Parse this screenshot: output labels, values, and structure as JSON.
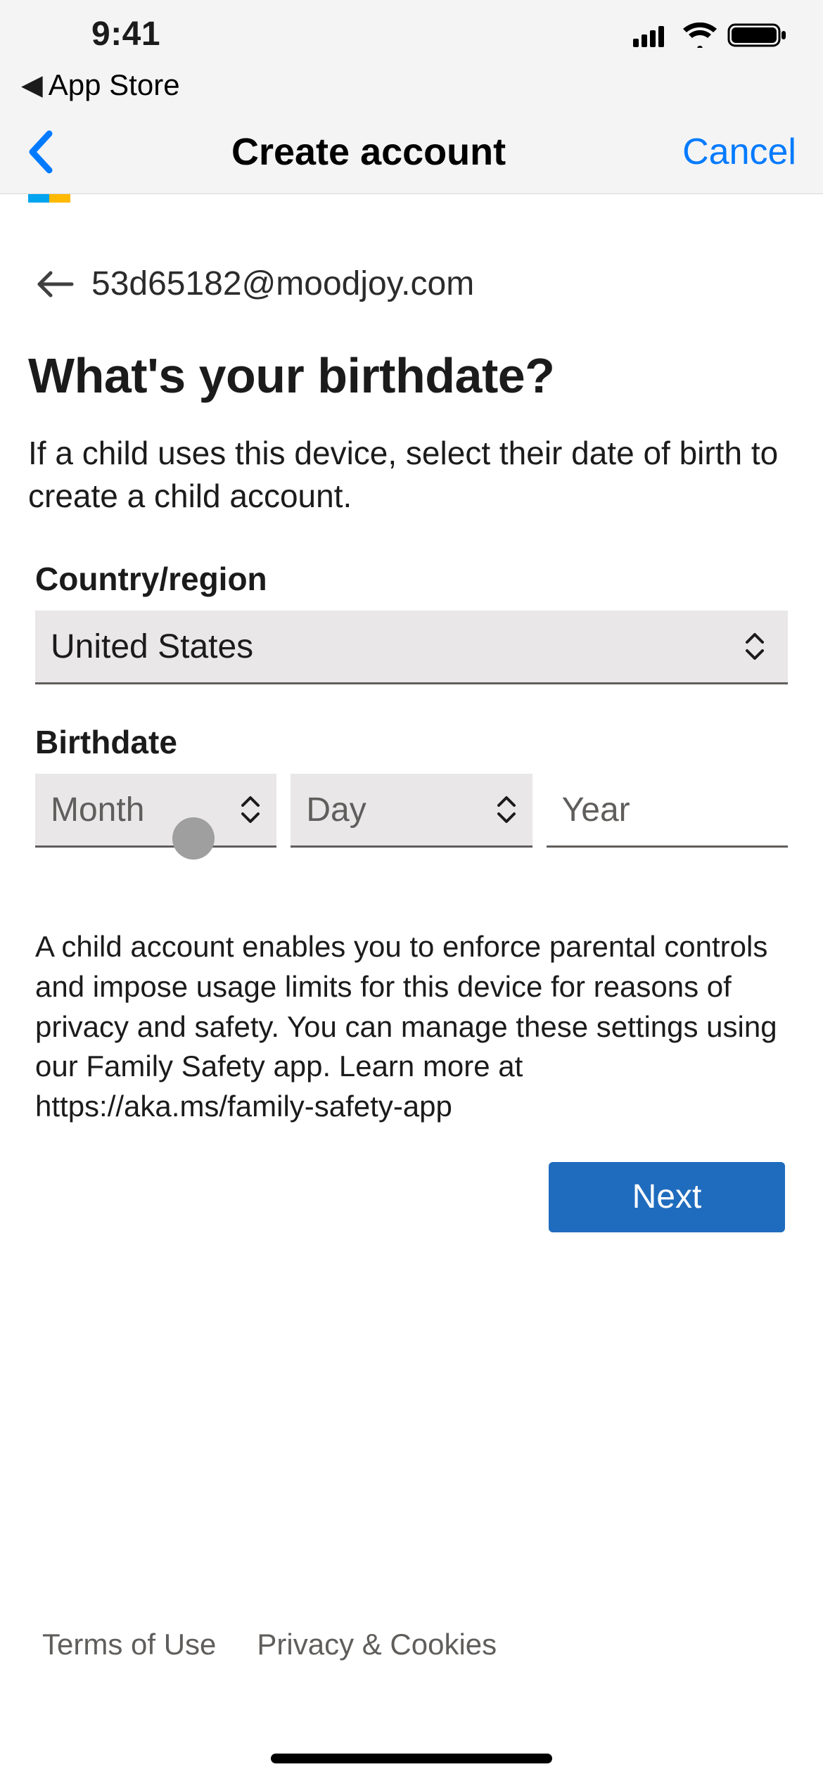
{
  "status": {
    "time": "9:41"
  },
  "back_app": {
    "label": "App Store"
  },
  "nav": {
    "title": "Create account",
    "cancel": "Cancel"
  },
  "email": "53d65182@moodjoy.com",
  "heading": "What's your birthdate?",
  "sub": "If a child uses this device, select their date of birth to create a child account.",
  "country": {
    "label": "Country/region",
    "value": "United States"
  },
  "birthdate": {
    "label": "Birthdate",
    "month": "Month",
    "day": "Day",
    "year": "Year"
  },
  "desc": "A child account enables you to enforce parental controls and impose usage limits for this device for reasons of privacy and safety. You can manage these settings using our Family Safety app. Learn more at https://aka.ms/family-safety-app",
  "next": "Next",
  "footer": {
    "terms": "Terms of Use",
    "privacy": "Privacy & Cookies"
  }
}
